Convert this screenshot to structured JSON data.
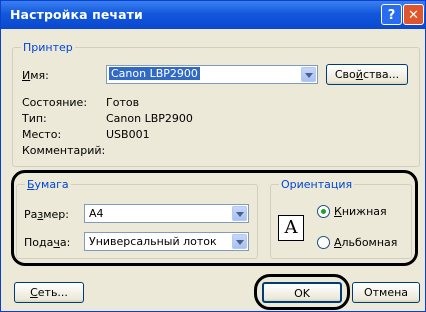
{
  "window": {
    "title": "Настройка печати"
  },
  "printer_group": {
    "legend": "Принтер",
    "name_label": "Имя:",
    "name_value": "Canon LBP2900",
    "properties_button": "Свойства...",
    "status_label": "Состояние:",
    "status_value": "Готов",
    "type_label": "Тип:",
    "type_value": "Canon LBP2900",
    "where_label": "Место:",
    "where_value": "USB001",
    "comment_label": "Комментарий:"
  },
  "paper_group": {
    "legend": "Бумага",
    "size_label": "Размер:",
    "size_value": "A4",
    "source_label": "Подача:",
    "source_value": "Универсальный лоток"
  },
  "orientation_group": {
    "legend": "Ориентация",
    "icon_letter": "A",
    "portrait": "Книжная",
    "landscape": "Альбомная",
    "selected": "Книжная"
  },
  "footer": {
    "network_button": "Сеть...",
    "ok_button": "OK",
    "cancel_button": "Отмена"
  }
}
